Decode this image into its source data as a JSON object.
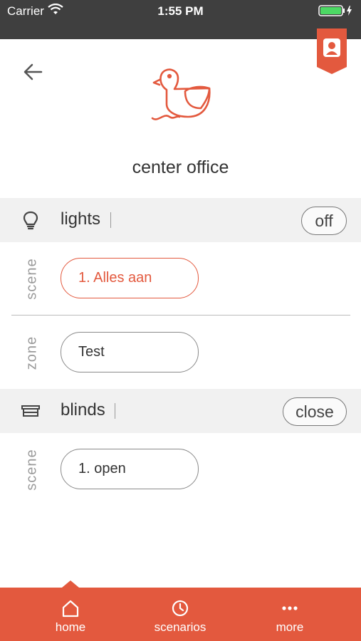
{
  "status_bar": {
    "carrier": "Carrier",
    "time": "1:55 PM"
  },
  "room": {
    "name": "center office"
  },
  "sections": {
    "lights": {
      "label": "lights",
      "action": "off",
      "scene": {
        "label": "scene",
        "value": "1. Alles aan"
      },
      "zone": {
        "label": "zone",
        "value": "Test"
      }
    },
    "blinds": {
      "label": "blinds",
      "action": "close",
      "scene": {
        "label": "scene",
        "value": "1. open"
      }
    }
  },
  "tabs": [
    {
      "label": "home",
      "icon": "home-icon"
    },
    {
      "label": "scenarios",
      "icon": "clock-icon"
    },
    {
      "label": "more",
      "icon": "more-icon"
    }
  ],
  "colors": {
    "accent": "#e3593e",
    "status_bar": "#3f3f3f",
    "section_bg": "#f1f1f1"
  }
}
